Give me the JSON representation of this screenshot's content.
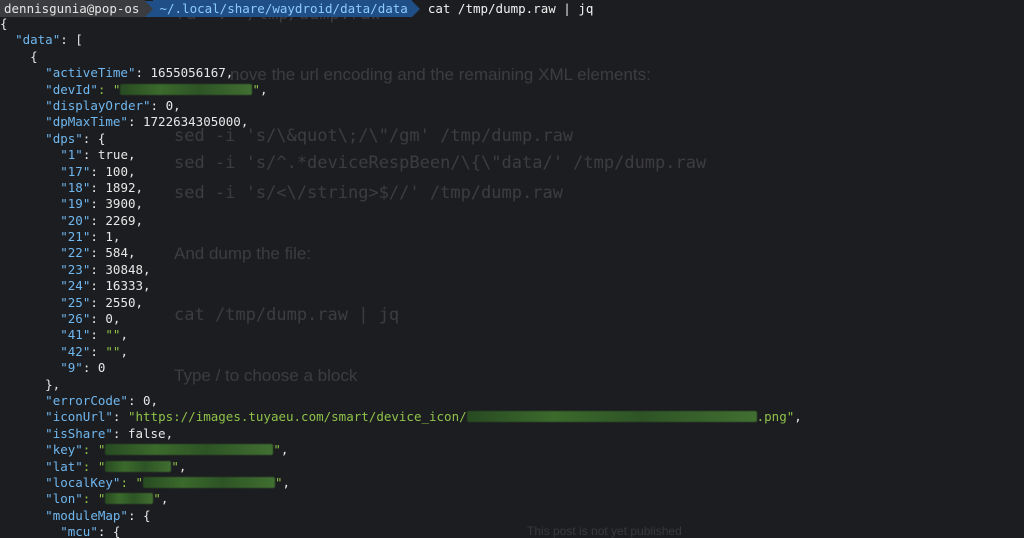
{
  "prompt": {
    "user_host": "dennisgunia@pop-os",
    "path": "~/.local/share/waydroid/data/data",
    "command": "cat /tmp/dump.raw | jq"
  },
  "background": {
    "top_fragment": "ra  .  /tmp/dump.raw",
    "line_remove": "nove the url encoding and the remaining XML elements:",
    "sed1": "sed -i 's/\\&quot\\;/\\\"/gm' /tmp/dump.raw",
    "sed2": "sed -i 's/^.*deviceRespBeen/\\{\\\"data/' /tmp/dump.raw",
    "sed3": "sed -i 's/<\\/string>$//' /tmp/dump.raw",
    "dump_text": "And dump the file:",
    "cat_cmd": "cat /tmp/dump.raw | jq",
    "type_hint": "Type / to choose a block",
    "unpublished": "This post is not yet published"
  },
  "json_lines": [
    {
      "indent": 0,
      "pre": "{"
    },
    {
      "indent": 1,
      "key": "data",
      "post": ": ["
    },
    {
      "indent": 2,
      "pre": "{"
    },
    {
      "indent": 3,
      "key": "activeTime",
      "post": ": 1655056167,"
    },
    {
      "indent": 3,
      "key": "devId",
      "post": ": \"",
      "redact": 132,
      "tail": "\","
    },
    {
      "indent": 3,
      "key": "displayOrder",
      "post": ": 0,"
    },
    {
      "indent": 3,
      "key": "dpMaxTime",
      "post": ": 1722634305000,"
    },
    {
      "indent": 3,
      "key": "dps",
      "post": ": {"
    },
    {
      "indent": 4,
      "key": "1",
      "post": ": true,"
    },
    {
      "indent": 4,
      "key": "17",
      "post": ": 100,"
    },
    {
      "indent": 4,
      "key": "18",
      "post": ": 1892,"
    },
    {
      "indent": 4,
      "key": "19",
      "post": ": 3900,"
    },
    {
      "indent": 4,
      "key": "20",
      "post": ": 2269,"
    },
    {
      "indent": 4,
      "key": "21",
      "post": ": 1,"
    },
    {
      "indent": 4,
      "key": "22",
      "post": ": 584,"
    },
    {
      "indent": 4,
      "key": "23",
      "post": ": 30848,"
    },
    {
      "indent": 4,
      "key": "24",
      "post": ": 16333,"
    },
    {
      "indent": 4,
      "key": "25",
      "post": ": 2550,"
    },
    {
      "indent": 4,
      "key": "26",
      "post": ": 0,"
    },
    {
      "indent": 4,
      "key": "41",
      "post": ": ",
      "str": "\"\"",
      "tail": ","
    },
    {
      "indent": 4,
      "key": "42",
      "post": ": ",
      "str": "\"\"",
      "tail": ","
    },
    {
      "indent": 4,
      "key": "9",
      "post": ": 0"
    },
    {
      "indent": 3,
      "pre": "},"
    },
    {
      "indent": 3,
      "key": "errorCode",
      "post": ": 0,"
    },
    {
      "indent": 3,
      "key": "iconUrl",
      "post": ": ",
      "str": "\"https://images.tuyaeu.com/smart/device_icon/",
      "redact": 290,
      "str2": ".png\"",
      "tail": ","
    },
    {
      "indent": 3,
      "key": "isShare",
      "post": ": false,"
    },
    {
      "indent": 3,
      "key": "key",
      "post": ": \"",
      "redact": 168,
      "tail": "\","
    },
    {
      "indent": 3,
      "key": "lat",
      "post": ": \"",
      "redact": 66,
      "tail": "\","
    },
    {
      "indent": 3,
      "key": "localKey",
      "post": ": \"",
      "redact": 132,
      "tail": "\","
    },
    {
      "indent": 3,
      "key": "lon",
      "post": ": \"",
      "redact": 48,
      "tail": "\","
    },
    {
      "indent": 3,
      "key": "moduleMap",
      "post": ": {"
    },
    {
      "indent": 4,
      "key": "mcu",
      "post": ": {"
    }
  ]
}
